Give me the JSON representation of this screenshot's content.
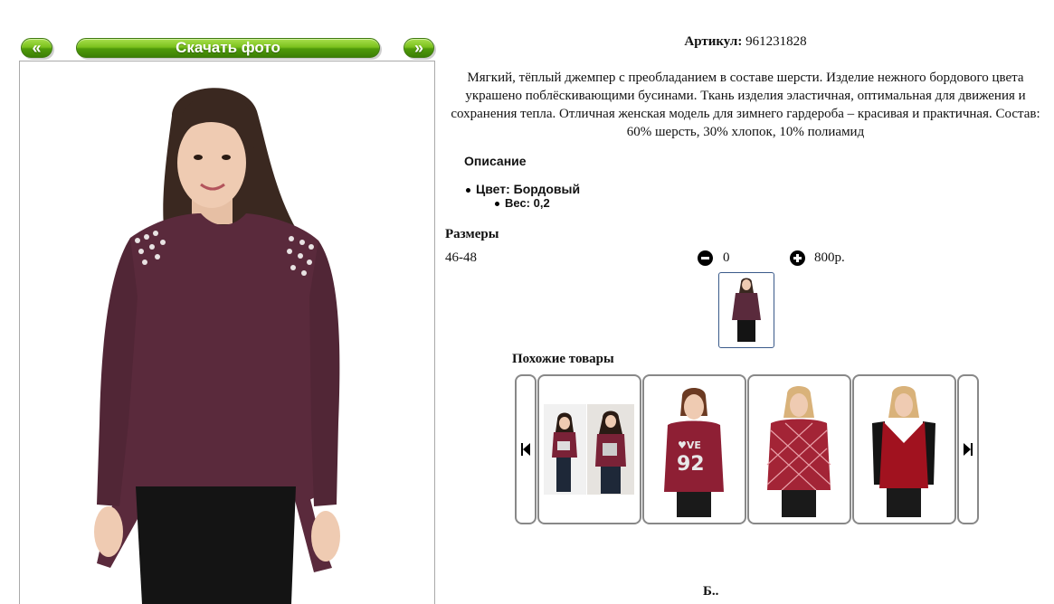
{
  "nav": {
    "prev_label": "«",
    "download_label": "Скачать фото",
    "next_label": "»"
  },
  "product": {
    "article_label": "Артикул:",
    "article_value": "961231828",
    "description": "Мягкий, тёплый джемпер с преобладанием в составе шерсти. Изделие нежного бордового цвета украшено поблёскивающими бусинами. Ткань изделия эластичная, оптимальная для движения и сохранения тепла. Отличная женская модель для зимнего гардероба – красивая и практичная. Состав: 60% шерсть, 30% хлопок, 10% полиамид",
    "details_title": "Описание",
    "color": "Цвет: Бордовый",
    "weight": "Вес: 0,2",
    "colors": {
      "sweater": "#5a2a3c",
      "accent_green": "#6db41c"
    }
  },
  "sizes": {
    "title": "Размеры",
    "rows": [
      {
        "size": "46-48",
        "quantity": "0",
        "price": "800р."
      }
    ]
  },
  "similar": {
    "title": "Похожие товары",
    "items": [
      {
        "icon": "product-photo-collage"
      },
      {
        "icon": "product-photo-love-92-sweater"
      },
      {
        "icon": "product-photo-argyle-sweater"
      },
      {
        "icon": "product-photo-red-vest"
      }
    ]
  },
  "footer_cut_text": "Б.."
}
